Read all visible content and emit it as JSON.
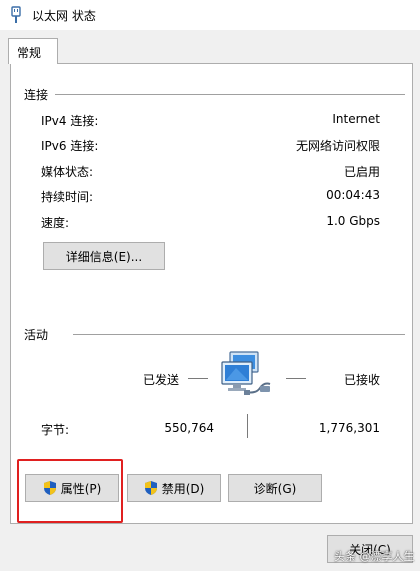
{
  "window": {
    "title": "以太网 状态"
  },
  "tabs": [
    {
      "label": "常规"
    }
  ],
  "connection": {
    "heading": "连接",
    "rows": [
      {
        "label": "IPv4 连接:",
        "value": "Internet"
      },
      {
        "label": "IPv6 连接:",
        "value": "无网络访问权限"
      },
      {
        "label": "媒体状态:",
        "value": "已启用"
      },
      {
        "label": "持续时间:",
        "value": "00:04:43"
      },
      {
        "label": "速度:",
        "value": "1.0 Gbps"
      }
    ],
    "details_button": "详细信息(E)..."
  },
  "activity": {
    "heading": "活动",
    "sent_label": "已发送",
    "received_label": "已接收",
    "bytes_label": "字节:",
    "bytes_sent": "550,764",
    "bytes_received": "1,776,301"
  },
  "buttons": {
    "properties": "属性(P)",
    "disable": "禁用(D)",
    "diagnose": "诊断(G)",
    "close": "关闭(C)"
  },
  "watermark": "头条 @漂享人生",
  "colors": {
    "highlight": "#e02020",
    "shield_blue": "#1f5fbf",
    "shield_yellow": "#f2c21a"
  }
}
